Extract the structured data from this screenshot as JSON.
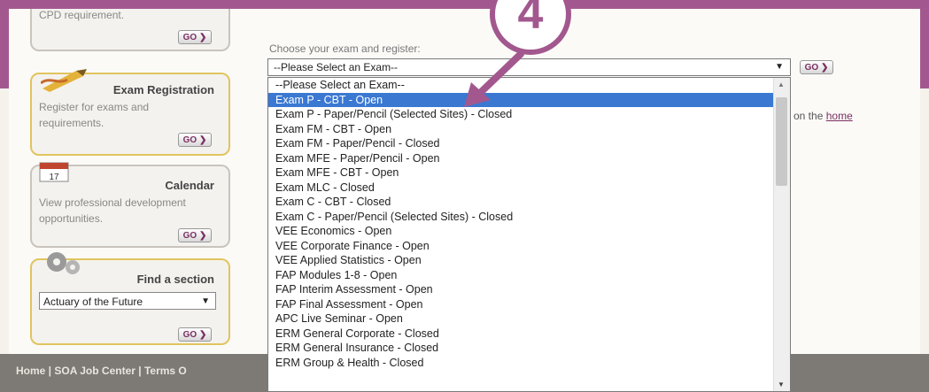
{
  "colors": {
    "accent": "#a2588e",
    "selection": "#3a78d2"
  },
  "sidebar": {
    "cpd_text": "CPD requirement.",
    "go_label": "GO",
    "exam_card": {
      "title": "Exam Registration",
      "text": "Register for exams and requirements.",
      "icon": "pencil-icon"
    },
    "calendar_card": {
      "title": "Calendar",
      "text": "View professional development opportunities.",
      "icon": "calendar-icon",
      "calendar_number": "17"
    },
    "find_card": {
      "title": "Find a section",
      "icon": "gear-icon",
      "select_value": "Actuary of the Future"
    }
  },
  "main": {
    "prompt": "Choose your exam and register:",
    "select_value": "--Please Select an Exam--",
    "go_label": "GO",
    "partial_text": "on the",
    "partial_link": "home"
  },
  "dropdown": {
    "options": [
      "--Please Select an Exam--",
      "Exam P - CBT - Open",
      "Exam P - Paper/Pencil (Selected Sites) - Closed",
      "Exam FM - CBT - Open",
      "Exam FM - Paper/Pencil - Closed",
      "Exam MFE - Paper/Pencil - Open",
      "Exam MFE - CBT - Open",
      "Exam MLC - Closed",
      "Exam C - CBT - Closed",
      "Exam C - Paper/Pencil (Selected Sites) - Closed",
      "VEE Economics - Open",
      "VEE Corporate Finance - Open",
      "VEE Applied Statistics - Open",
      "FAP Modules 1-8 - Open",
      "FAP Interim Assessment - Open",
      "FAP Final Assessment - Open",
      "APC Live Seminar - Open",
      "ERM General Corporate - Closed",
      "ERM General Insurance - Closed",
      "ERM Group & Health - Closed"
    ],
    "selected_index": 1
  },
  "footer": {
    "text": "Home  |  SOA Job Center  |  Terms O"
  },
  "callout": {
    "number": "4"
  }
}
